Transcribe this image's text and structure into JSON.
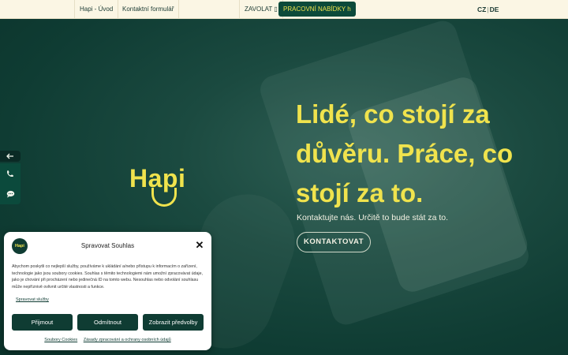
{
  "nav": {
    "home": "Hapi - Úvod",
    "contact_form": "Kontaktní formulář",
    "call": "ZAVOLAT ▯",
    "jobs": "PRACOVNÍ NABÍDKY h",
    "lang_cz": "CZ",
    "lang_sep": "|",
    "lang_de": "DE"
  },
  "colors": {
    "brand_yellow": "#f0e34d",
    "brand_green": "#0f3c33",
    "nav_bg": "#fbf6e4"
  },
  "hero": {
    "logo_text": "Hapi",
    "headline": "Lidé, co stojí za důvěru. Práce, co stojí za to.",
    "subhead": "Kontaktujte nás. Určitě to bude stát za to.",
    "cta": "KONTAKTOVAT"
  },
  "side_widget": {
    "back_icon": "arrow-left-icon",
    "phone_icon": "phone-icon",
    "chat_icon": "chat-icon"
  },
  "cookie_modal": {
    "logo_text": "Hapi",
    "title": "Spravovat Souhlas",
    "body": "Abychom poskytli co nejlepší služby, používáme k ukládání a/nebo přístupu k informacím o zařízení, technologie jako jsou soubory cookies. Souhlas s těmito technologiemi nám umožní zpracovávat údaje, jako je chování při procházení nebo jedinečná ID na tomto webu. Nesouhlas nebo odvolání souhlasu může nepříznivě ovlivnit určité vlastnosti a funkce.",
    "manage_services": "Spravovat služby",
    "accept": "Přijmout",
    "deny": "Odmítnout",
    "preferences": "Zobrazit předvolby",
    "cookies_link": "Soubory Cookies",
    "privacy_link": "Zásady zpracování a ochrany osobních údajů"
  }
}
